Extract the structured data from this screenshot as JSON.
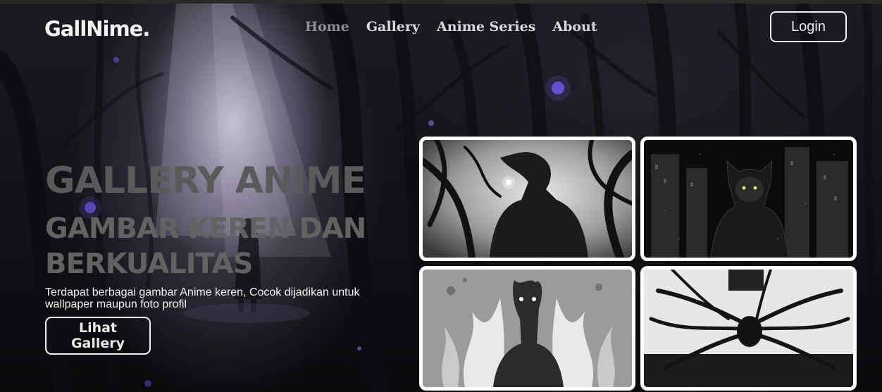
{
  "brand": {
    "logo_text": "GallNime."
  },
  "nav": {
    "items": [
      {
        "label": "Home",
        "active": true
      },
      {
        "label": "Gallery",
        "active": false
      },
      {
        "label": "Anime Series",
        "active": false
      },
      {
        "label": "About",
        "active": false
      }
    ],
    "login_label": "Login"
  },
  "hero": {
    "title": "GALLERY ANIME",
    "subtitle": "GAMBAR KEREN DAN BERKUALITAS",
    "description": "Terdapat berbagai gambar Anime keren, Cocok dijadikan untuk wallpaper maupun foto profil",
    "cta_label": "Lihat Gallery"
  },
  "gallery": {
    "images": [
      {
        "name": "anime-boy-glowing-eye-forest"
      },
      {
        "name": "hooded-cat-ear-figure-city-night"
      },
      {
        "name": "boy-white-flame-aura"
      },
      {
        "name": "dark-winged-figure-chains"
      }
    ]
  },
  "colors": {
    "background": "#0c0b10",
    "title_grey": "#5a5a5a",
    "subtitle_grey": "#626262",
    "nav_active": "#8f8f8f",
    "nav_text": "#d9d9d9",
    "border_light": "#ffffff",
    "border_dark": "#6c6c6c",
    "glow_purple": "#7b5cff"
  }
}
